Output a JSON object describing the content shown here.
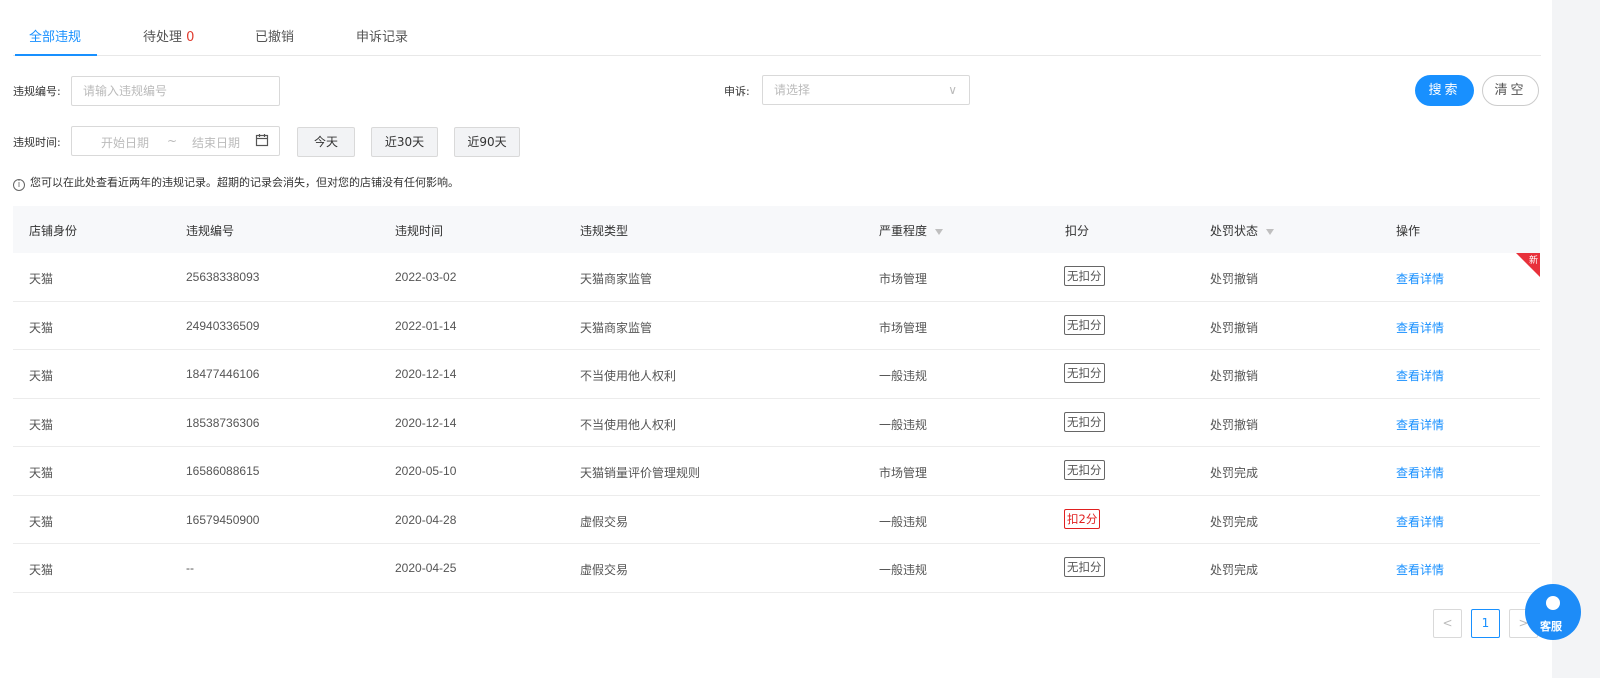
{
  "tabs": [
    {
      "label": "全部违规"
    },
    {
      "label": "待处理",
      "count": "0"
    },
    {
      "label": "已撤销"
    },
    {
      "label": "申诉记录"
    }
  ],
  "filters": {
    "violation_no_label": "违规编号:",
    "violation_no_placeholder": "请输入违规编号",
    "appeal_label": "申诉:",
    "appeal_placeholder": "请选择",
    "time_label": "违规时间:",
    "start_placeholder": "开始日期",
    "range_sep": "~",
    "end_placeholder": "结束日期",
    "quick_today": "今天",
    "quick_30": "近30天",
    "quick_90": "近90天",
    "search": "搜索",
    "clear": "清空"
  },
  "notice": "您可以在此处查看近两年的违规记录。超期的记录会消失，但对您的店铺没有任何影响。",
  "table": {
    "headers": [
      "店铺身份",
      "违规编号",
      "违规时间",
      "违规类型",
      "严重程度",
      "扣分",
      "处罚状态",
      "操作"
    ],
    "rows": [
      {
        "shop": "天猫",
        "no": "25638338093",
        "date": "2022-03-02",
        "type": "天猫商家监管",
        "severity": "市场管理",
        "points": "无扣分",
        "status": "处罚撤销",
        "action": "查看详情",
        "new": "新"
      },
      {
        "shop": "天猫",
        "no": "24940336509",
        "date": "2022-01-14",
        "type": "天猫商家监管",
        "severity": "市场管理",
        "points": "无扣分",
        "status": "处罚撤销",
        "action": "查看详情"
      },
      {
        "shop": "天猫",
        "no": "18477446106",
        "date": "2020-12-14",
        "type": "不当使用他人权利",
        "severity": "一般违规",
        "points": "无扣分",
        "status": "处罚撤销",
        "action": "查看详情"
      },
      {
        "shop": "天猫",
        "no": "18538736306",
        "date": "2020-12-14",
        "type": "不当使用他人权利",
        "severity": "一般违规",
        "points": "无扣分",
        "status": "处罚撤销",
        "action": "查看详情"
      },
      {
        "shop": "天猫",
        "no": "16586088615",
        "date": "2020-05-10",
        "type": "天猫销量评价管理规则",
        "severity": "市场管理",
        "points": "无扣分",
        "status": "处罚完成",
        "action": "查看详情"
      },
      {
        "shop": "天猫",
        "no": "16579450900",
        "date": "2020-04-28",
        "type": "虚假交易",
        "severity": "一般违规",
        "points": "扣2分",
        "status": "处罚完成",
        "action": "查看详情"
      },
      {
        "shop": "天猫",
        "no": "--",
        "date": "2020-04-25",
        "type": "虚假交易",
        "severity": "一般违规",
        "points": "无扣分",
        "status": "处罚完成",
        "action": "查看详情"
      }
    ]
  },
  "pagination": {
    "prev": "<",
    "current": "1",
    "next": ">"
  },
  "service": {
    "label": "客服"
  },
  "colors": {
    "accent": "#1890ff",
    "danger": "#e02020"
  }
}
